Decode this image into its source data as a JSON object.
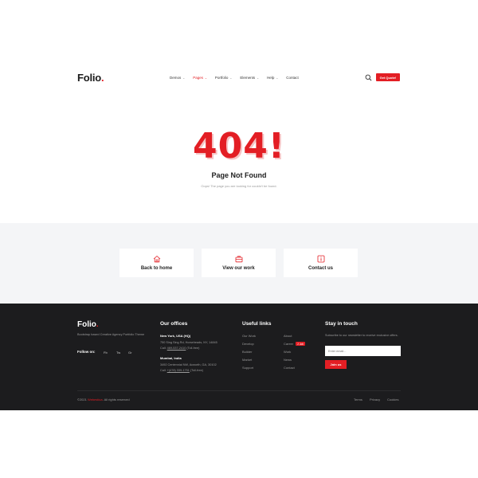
{
  "header": {
    "logo": "Folio",
    "logo_dot": ".",
    "nav": [
      {
        "label": "Demos",
        "active": false,
        "dropdown": true
      },
      {
        "label": "Pages",
        "active": true,
        "dropdown": true
      },
      {
        "label": "Portfolio",
        "active": false,
        "dropdown": true
      },
      {
        "label": "Elements",
        "active": false,
        "dropdown": true
      },
      {
        "label": "Help",
        "active": false,
        "dropdown": true
      },
      {
        "label": "Contact",
        "active": false,
        "dropdown": false
      }
    ],
    "quote_button": "Get Quote!"
  },
  "error": {
    "code": "404!",
    "title": "Page Not Found",
    "subtitle": "Oops! The page you are looking for couldn't be found."
  },
  "cards": [
    {
      "label": "Back to home",
      "icon": "home-icon"
    },
    {
      "label": "View our work",
      "icon": "briefcase-icon"
    },
    {
      "label": "Contact us",
      "icon": "info-icon"
    }
  ],
  "footer": {
    "logo": "Folio",
    "logo_dot": ".",
    "description": "Bootstrap based Creative Agency Portfolio Theme",
    "follow_label": "Follow on:",
    "social": [
      "Fb",
      "Tw",
      "Gr"
    ],
    "offices_title": "Our offices",
    "offices": [
      {
        "city": "New York, USA (HQ)",
        "address": "750 Sing Sing Rd, Horseheads, NY, 14845",
        "call_label": "Call:",
        "phone": "469-537-2410",
        "hours": "(Toll-free)"
      },
      {
        "city": "Mumbai, India",
        "address": "3492 Centennial NW, Acworth, GA, 30102",
        "call_label": "Call:",
        "phone": "+(478) 339-1751",
        "hours": "(Toll-free)"
      }
    ],
    "links_title": "Useful links",
    "links_col1": [
      "Our Work",
      "Develop",
      "Builder",
      "Market",
      "Support"
    ],
    "links_col2": [
      "About",
      "Career",
      "Work",
      "News",
      "Contact"
    ],
    "hiring_badge": "2 Job",
    "newsletter_title": "Stay in touch",
    "newsletter_text": "Subscribe to our newsletter to receive exclusive offers.",
    "email_placeholder": "Enter email...",
    "join_button": "Join us",
    "copyright_prefix": "©2021",
    "copyright_brand": "Webestica",
    "copyright_suffix": ". All rights reserved",
    "bottom_links": [
      "Terms",
      "Privacy",
      "Cookies"
    ]
  },
  "colors": {
    "accent": "#e31e24",
    "footer_bg": "#1c1c1e",
    "band_bg": "#f4f5f7"
  }
}
